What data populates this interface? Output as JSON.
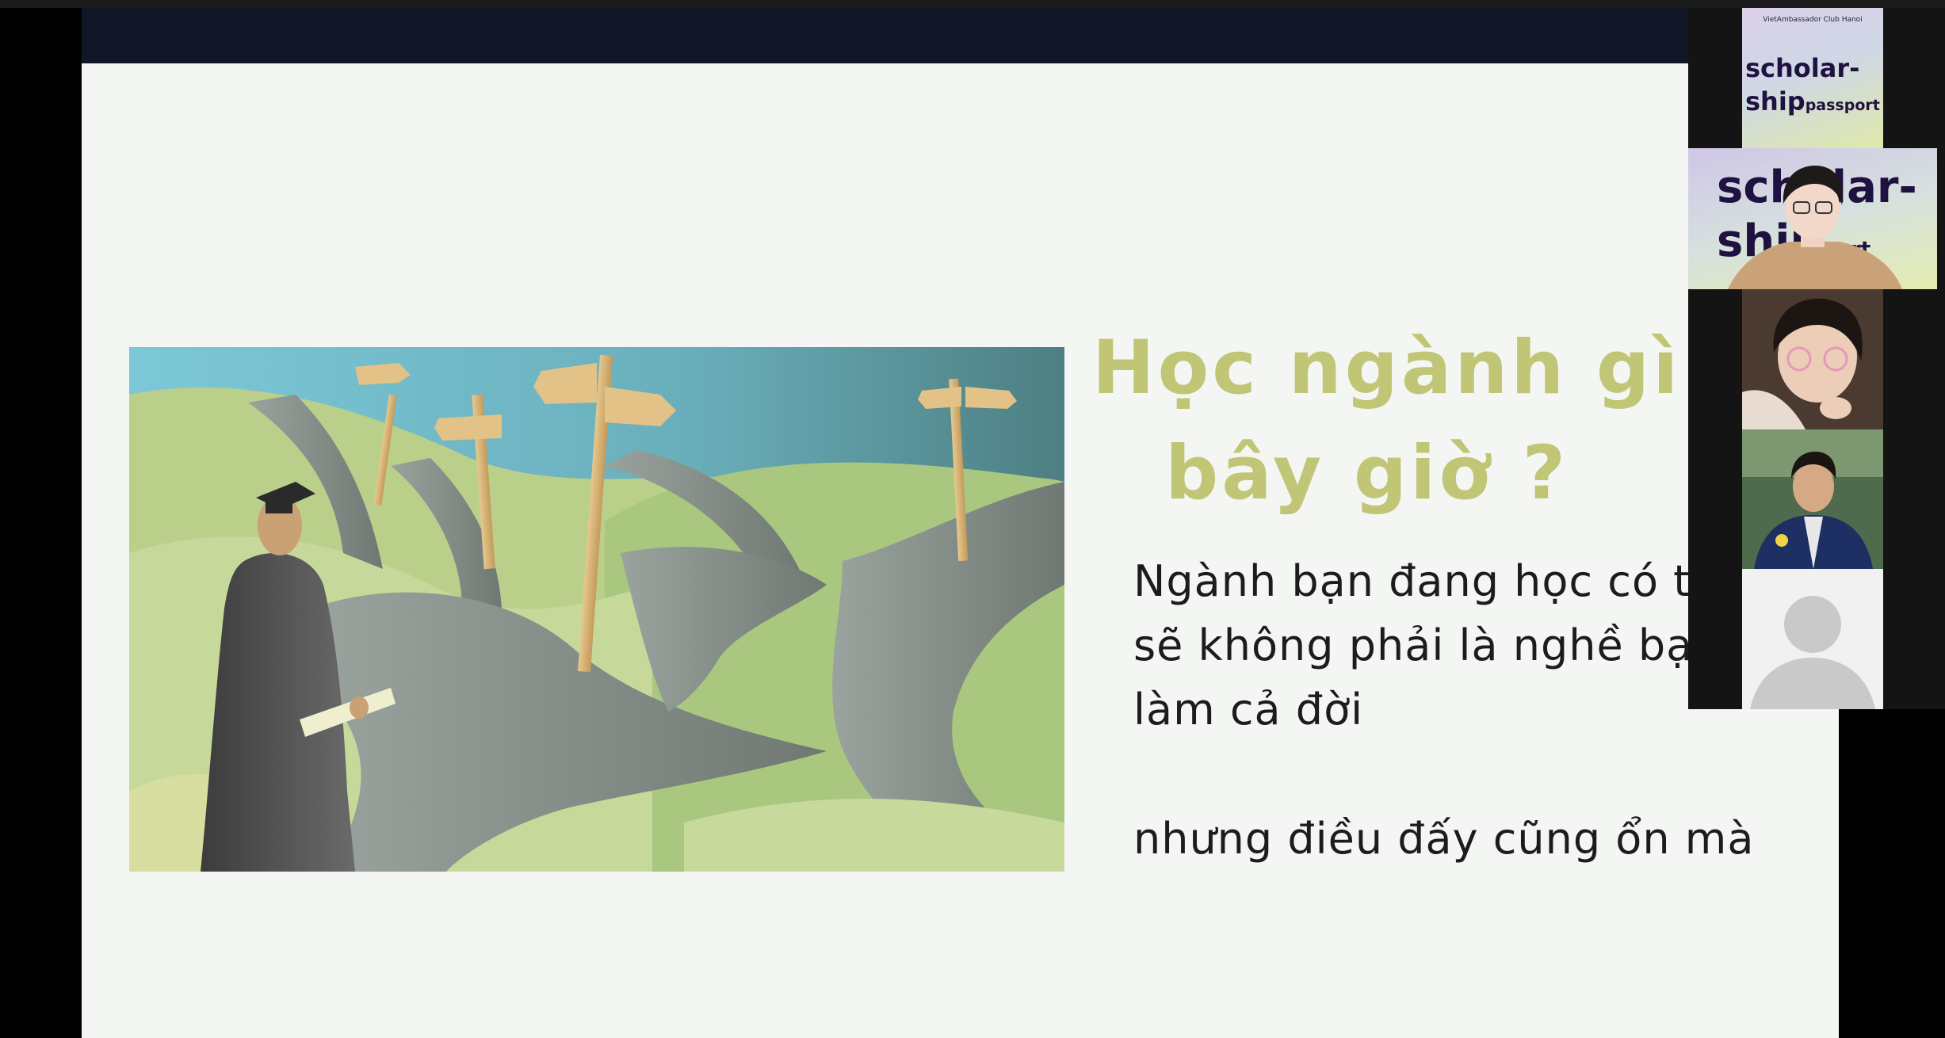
{
  "slide": {
    "title_line1": "Học ngành gì",
    "title_line2": "bây giờ ?",
    "body_line1": "Ngành bạn đang học có t",
    "body_line2": "sẽ không phải là nghề bạn",
    "body_line3": "làm cả đời",
    "body_line4": "nhưng điều đấy cũng ổn mà"
  },
  "participants": {
    "tile1_caption": "VietAmbassador Club Hanoi",
    "brand_word1": "scholar-",
    "brand_word2": "ship",
    "brand_word3": "passport",
    "tile2_word1": "scholar-",
    "tile2_word2": "ship",
    "tile2_word3": "port"
  },
  "colors": {
    "accent": "#c0c675",
    "slide_background": "#f4f6f4",
    "header_bar": "#111726",
    "text": "#1c1c1c"
  }
}
